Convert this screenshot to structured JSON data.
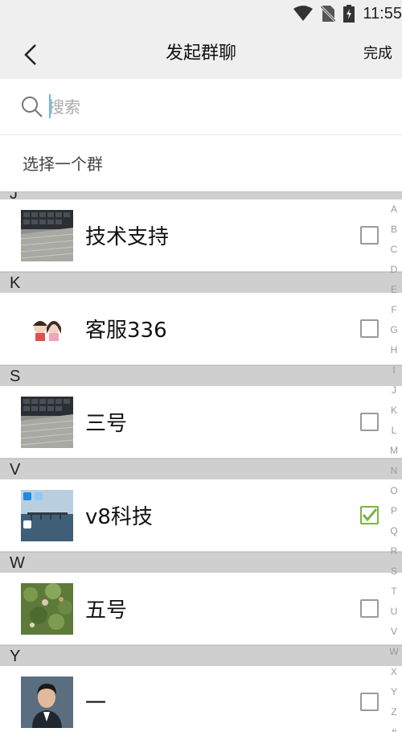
{
  "status_bar": {
    "time": "11:55"
  },
  "app_bar": {
    "title": "发起群聊",
    "done_label": "完成"
  },
  "search": {
    "placeholder": "搜索",
    "value": ""
  },
  "select_group_label": "选择一个群",
  "contacts": [
    {
      "section": "J",
      "name": "技术支持",
      "checked": false,
      "avatar_icon": "keyboard-photo"
    },
    {
      "section": "K",
      "name": "客服336",
      "checked": false,
      "avatar_icon": "cartoon-couple"
    },
    {
      "section": "S",
      "name": "三号",
      "checked": false,
      "avatar_icon": "keyboard-photo"
    },
    {
      "section": "V",
      "name": "v8科技",
      "checked": true,
      "avatar_icon": "pier-seascape-photo"
    },
    {
      "section": "W",
      "name": "五号",
      "checked": false,
      "avatar_icon": "garden-plants-photo"
    },
    {
      "section": "Y",
      "name": "一",
      "checked": false,
      "avatar_icon": "man-portrait-photo"
    }
  ],
  "index_letters": [
    "A",
    "B",
    "C",
    "D",
    "E",
    "F",
    "G",
    "H",
    "I",
    "J",
    "K",
    "L",
    "M",
    "N",
    "O",
    "P",
    "Q",
    "R",
    "S",
    "T",
    "U",
    "V",
    "W",
    "X",
    "Y",
    "Z",
    "#"
  ],
  "colors": {
    "accent_check": "#7cb342",
    "section_bg": "#cfcfcf",
    "bar_bg": "#efefef"
  }
}
